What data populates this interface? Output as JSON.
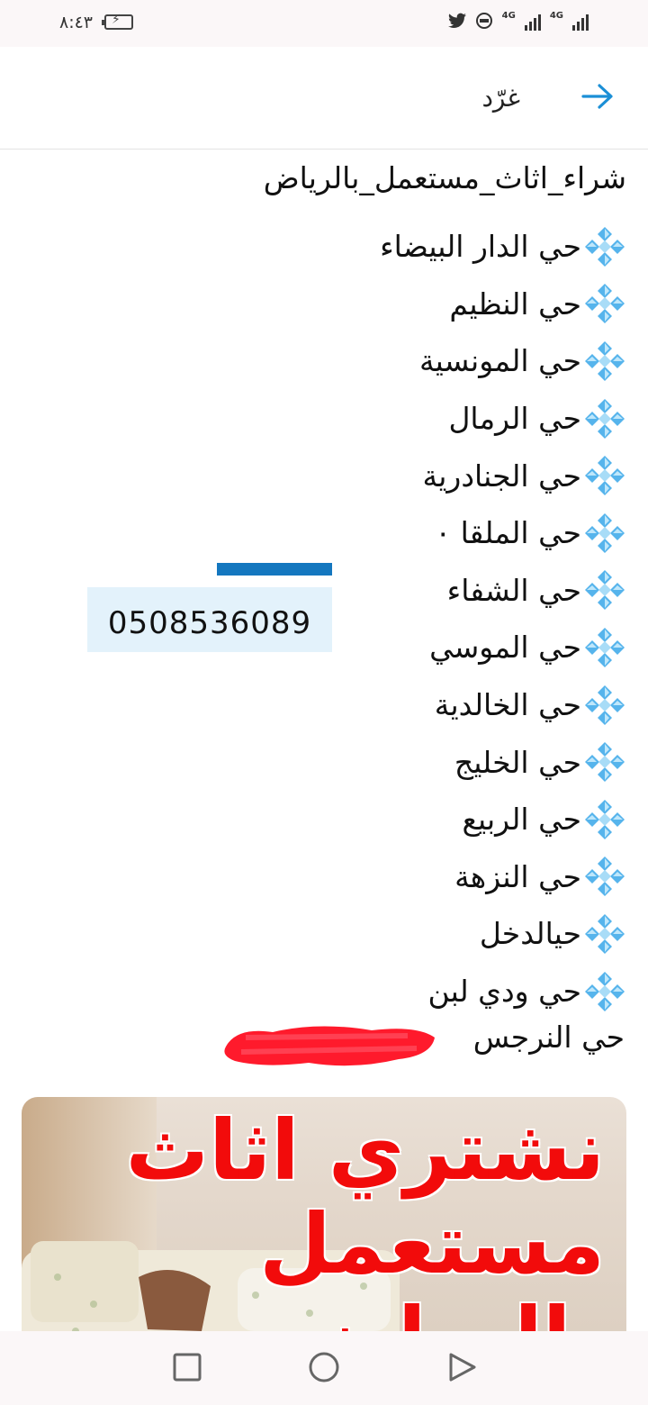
{
  "status_bar": {
    "time": "٨:٤٣",
    "network_labels": [
      "4G",
      "4G"
    ],
    "icons": [
      "battery-icon",
      "twitter-icon",
      "data-saver-icon",
      "signal-icon",
      "signal-icon"
    ]
  },
  "header": {
    "title": "غرّد",
    "back_icon": "arrow-right-icon"
  },
  "post": {
    "hashtag": "شراء_اثاث_مستعمل_بالرياض",
    "bullet_icon": "blue-diamond-icon",
    "districts": [
      "حي الدار البيضاء",
      "حي النظيم",
      "حي المونسية",
      "حي الرمال",
      "حي الجنادرية",
      "حي الملقا ٠",
      "حي الشفاء",
      "حي الموسي",
      "حي الخالدية",
      "حي الخليج",
      "حي الربيع",
      "حي النزهة",
      "حيالدخل",
      "حي ودي لبن"
    ],
    "last_line": "حي النرجس"
  },
  "phone_card": {
    "number": "0508536089"
  },
  "ad": {
    "line1": "نشتري اثاث",
    "line2": "مستعمل",
    "line3": "بالرياض"
  },
  "nav_bar": {
    "icons": [
      "recents-square-icon",
      "home-circle-icon",
      "back-triangle-icon"
    ]
  },
  "colors": {
    "accent": "#1b8fd6",
    "ad_text": "#f20b0b",
    "redaction": "#ff1a2c",
    "phone_box_bg": "#e3f2fb"
  }
}
